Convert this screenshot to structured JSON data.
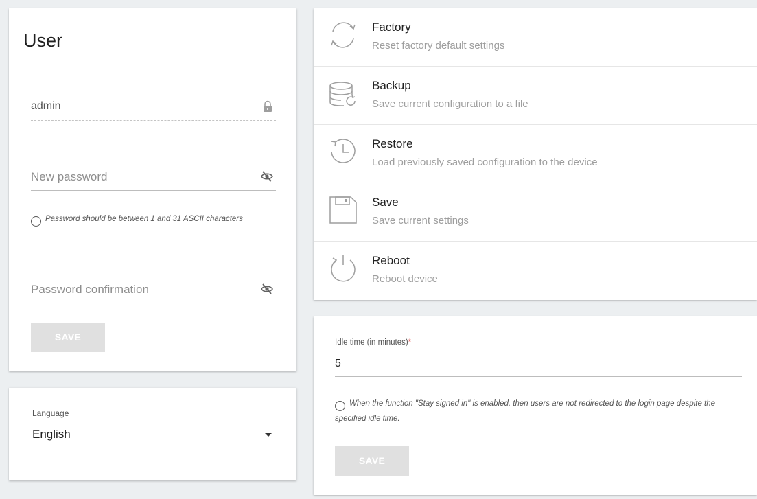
{
  "user": {
    "title": "User",
    "login_value": "admin",
    "new_password_placeholder": "New password",
    "password_hint": "Password should be between 1 and 31 ASCII characters",
    "confirm_password_placeholder": "Password confirmation",
    "save_label": "SAVE"
  },
  "language": {
    "label": "Language",
    "selected": "English"
  },
  "actions": [
    {
      "title": "Factory",
      "description": "Reset factory default settings",
      "icon": "refresh-icon"
    },
    {
      "title": "Backup",
      "description": "Save current configuration to a file",
      "icon": "database-backup-icon"
    },
    {
      "title": "Restore",
      "description": "Load previously saved configuration to the device",
      "icon": "history-icon"
    },
    {
      "title": "Save",
      "description": "Save current settings",
      "icon": "floppy-icon"
    },
    {
      "title": "Reboot",
      "description": "Reboot device",
      "icon": "power-icon"
    }
  ],
  "idle": {
    "label": "Idle time (in minutes)",
    "required_mark": "*",
    "value": "5",
    "hint": "When the function \"Stay signed in\" is enabled, then users are not redirected to the login page despite the specified idle time.",
    "save_label": "SAVE"
  },
  "colors": {
    "background": "#eceff1",
    "disabled_button": "#e0e0e0",
    "required": "#e53935"
  }
}
